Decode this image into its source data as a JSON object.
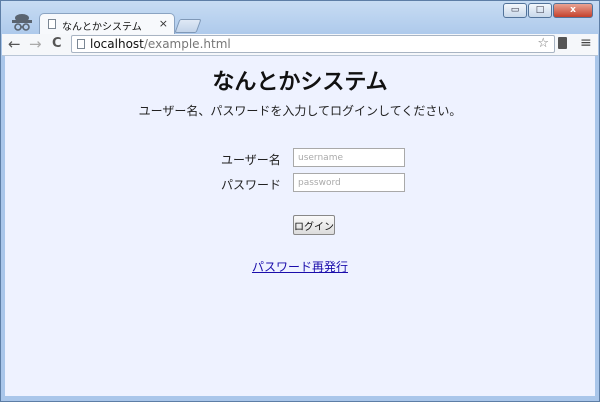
{
  "browser": {
    "tab_title": "なんとかシステム",
    "tab_close": "×",
    "url_host": "localhost",
    "url_path": "/example.html",
    "back": "←",
    "forward": "→",
    "reload": "C",
    "star": "☆",
    "menu": "≡",
    "minimize": "▭",
    "restore": "□",
    "close": "x"
  },
  "page": {
    "title": "なんとかシステム",
    "instruction": "ユーザー名、パスワードを入力してログインしてください。",
    "username_label": "ユーザー名",
    "username_placeholder": "username",
    "password_label": "パスワード",
    "password_placeholder": "password",
    "login_button": "ログイン",
    "reissue_link": "パスワード再発行"
  }
}
